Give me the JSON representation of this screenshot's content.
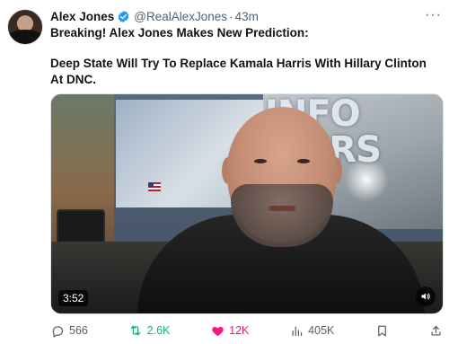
{
  "author": {
    "display_name": "Alex Jones",
    "handle": "@RealAlexJones",
    "separator": "·",
    "time": "43m",
    "verified": true,
    "avatar_icon": "profile-photo"
  },
  "menu": {
    "more_label": "···"
  },
  "post": {
    "headline": "Breaking! Alex Jones Makes New Prediction:",
    "body": "Deep State Will Try To Replace Kamala Harris With Hillary Clinton At DNC."
  },
  "media": {
    "type": "video",
    "overlay_text": "INFO WARS",
    "duration": "3:52",
    "volume_icon": "speaker-icon"
  },
  "actions": {
    "replies": "566",
    "reposts": "2.6K",
    "likes": "12K",
    "views": "405K",
    "bookmark_icon": "bookmark-icon",
    "share_icon": "share-icon"
  },
  "colors": {
    "verified": "#1d9bf0",
    "repost": "#00ba7c",
    "like": "#f91880",
    "secondary_text": "#536471"
  }
}
